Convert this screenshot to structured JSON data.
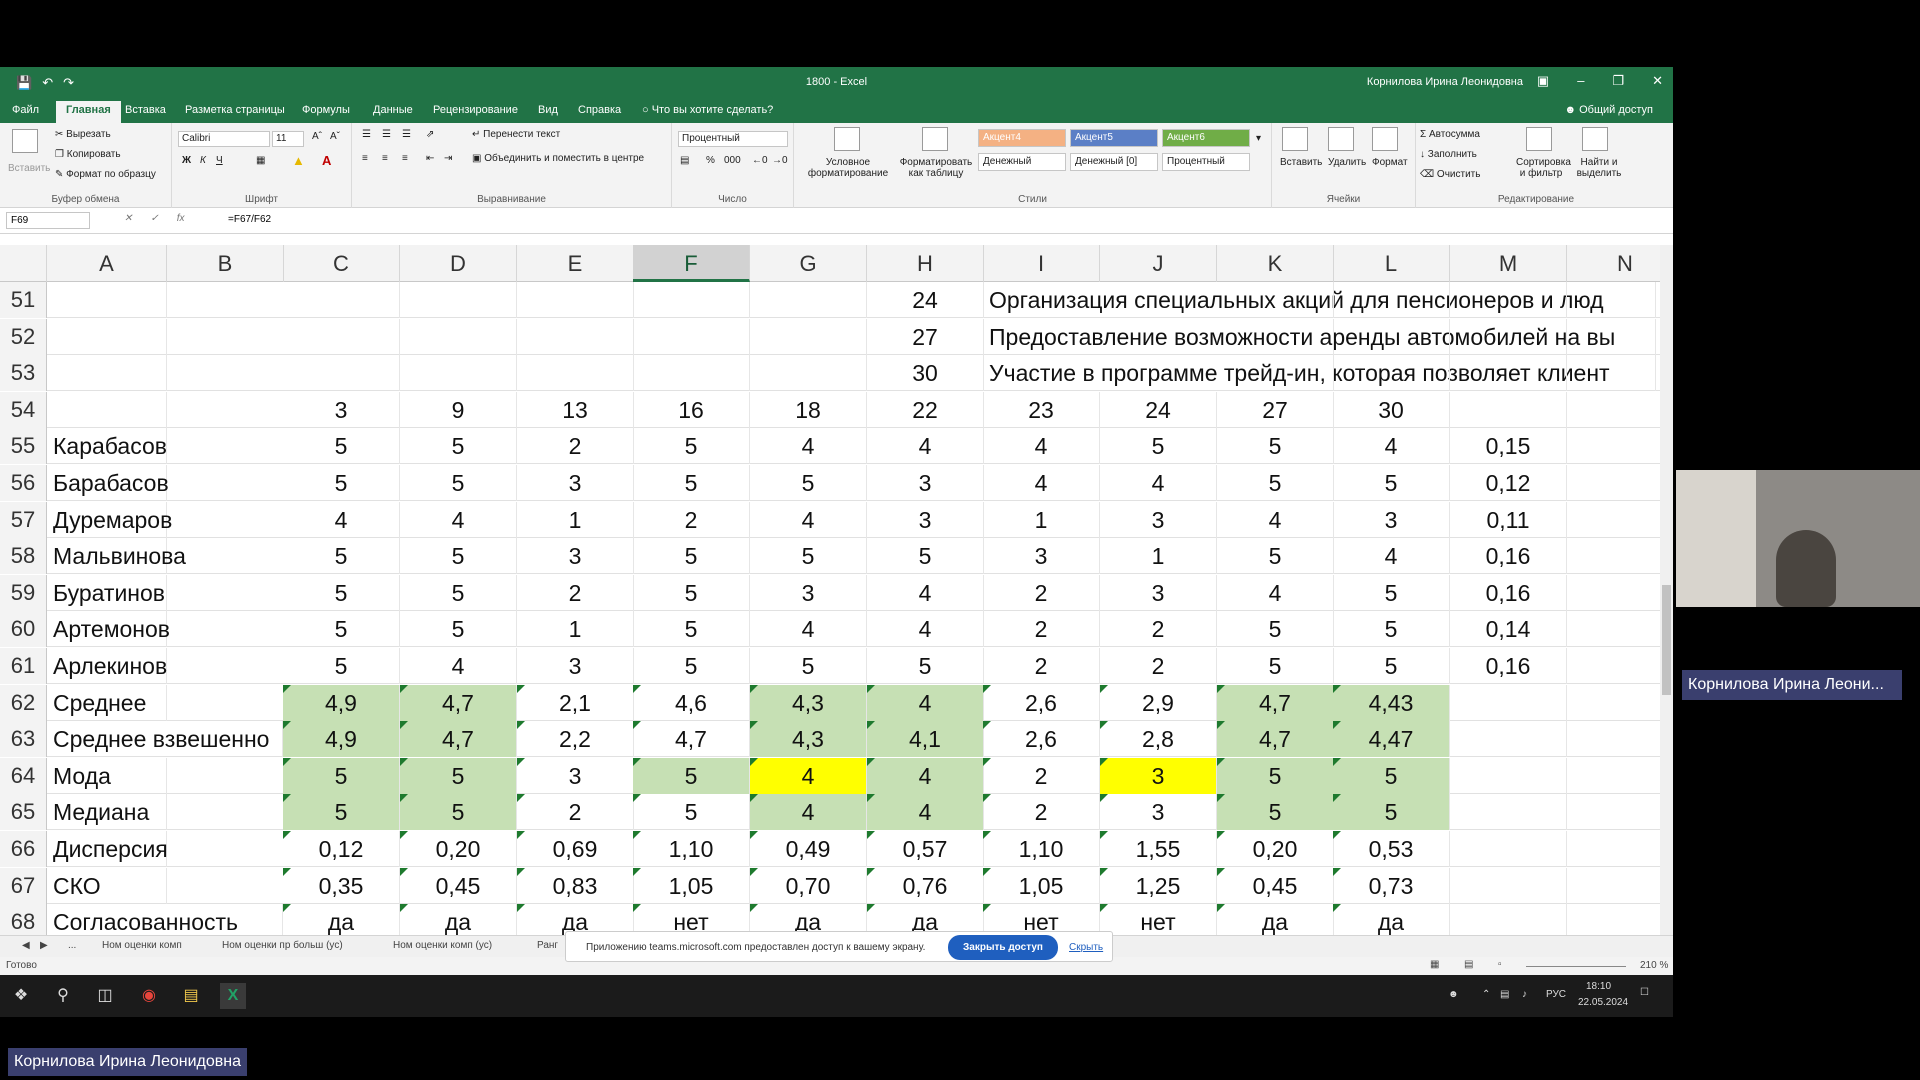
{
  "title": {
    "doc": "1800",
    "app": "Excel",
    "user": "Корнилова Ирина Леонидовна"
  },
  "tabs": [
    "Файл",
    "Главная",
    "Вставка",
    "Разметка страницы",
    "Формулы",
    "Данные",
    "Рецензирование",
    "Вид",
    "Справка",
    "Что вы хотите сделать?"
  ],
  "share": "Общий доступ",
  "ribbon": {
    "clipboard": {
      "paste": "Вставить",
      "cut": "Вырезать",
      "copy": "Копировать",
      "format_painter": "Формат по образцу",
      "label": "Буфер обмена"
    },
    "font": {
      "name": "Calibri",
      "size": "11",
      "bold": "Ж",
      "italic": "К",
      "underline": "Ч",
      "label": "Шрифт"
    },
    "alignment": {
      "wrap": "Перенести текст",
      "merge": "Объединить и поместить в центре",
      "label": "Выравнивание"
    },
    "number": {
      "format": "Процентный",
      "label": "Число"
    },
    "styles": {
      "cond": "Условное форматирование",
      "table": "Форматировать как таблицу",
      "a4": "Акцент4",
      "a5": "Акцент5",
      "a6": "Акцент6",
      "money": "Денежный",
      "money0": "Денежный [0]",
      "pct": "Процентный",
      "label": "Стили"
    },
    "cells": {
      "insert": "Вставить",
      "delete": "Удалить",
      "format": "Формат",
      "label": "Ячейки"
    },
    "editing": {
      "autosum": "Автосумма",
      "fill": "Заполнить",
      "clear": "Очистить",
      "sort": "Сортировка и фильтр",
      "find": "Найти и выделить",
      "label": "Редактирование"
    }
  },
  "namebox": "F69",
  "formula": "=F67/F62",
  "columns": [
    "A",
    "B",
    "C",
    "D",
    "E",
    "F",
    "G",
    "H",
    "I",
    "J",
    "K",
    "L",
    "M",
    "N"
  ],
  "rows": [
    {
      "n": "51",
      "A": "",
      "C": "",
      "D": "",
      "E": "",
      "F": "",
      "G": "",
      "H": "24",
      "I": "Организация специальных акций для пенсионеров и люд",
      "K": "",
      "L": "",
      "M": ""
    },
    {
      "n": "52",
      "A": "",
      "C": "",
      "D": "",
      "E": "",
      "F": "",
      "G": "",
      "H": "27",
      "I": "Предоставление возможности аренды автомобилей на вы",
      "K": "",
      "L": "",
      "M": ""
    },
    {
      "n": "53",
      "A": "",
      "C": "",
      "D": "",
      "E": "",
      "F": "",
      "G": "",
      "H": "30",
      "I": "Участие в программе трейд-ин, которая позволяет клиент",
      "K": "",
      "L": "",
      "M": ""
    },
    {
      "n": "54",
      "A": "",
      "C": "3",
      "D": "9",
      "E": "13",
      "F": "16",
      "G": "18",
      "H": "22",
      "I": "23",
      "J": "24",
      "K": "27",
      "L": "30",
      "M": ""
    },
    {
      "n": "55",
      "A": "Карабасов",
      "C": "5",
      "D": "5",
      "E": "2",
      "F": "5",
      "G": "4",
      "H": "4",
      "I": "4",
      "J": "5",
      "K": "5",
      "L": "4",
      "M": "0,15"
    },
    {
      "n": "56",
      "A": "Барабасов",
      "C": "5",
      "D": "5",
      "E": "3",
      "F": "5",
      "G": "5",
      "H": "3",
      "I": "4",
      "J": "4",
      "K": "5",
      "L": "5",
      "M": "0,12"
    },
    {
      "n": "57",
      "A": "Дуремаров",
      "C": "4",
      "D": "4",
      "E": "1",
      "F": "2",
      "G": "4",
      "H": "3",
      "I": "1",
      "J": "3",
      "K": "4",
      "L": "3",
      "M": "0,11"
    },
    {
      "n": "58",
      "A": "Мальвинова",
      "C": "5",
      "D": "5",
      "E": "3",
      "F": "5",
      "G": "5",
      "H": "5",
      "I": "3",
      "J": "1",
      "K": "5",
      "L": "4",
      "M": "0,16"
    },
    {
      "n": "59",
      "A": "Буратинов",
      "C": "5",
      "D": "5",
      "E": "2",
      "F": "5",
      "G": "3",
      "H": "4",
      "I": "2",
      "J": "3",
      "K": "4",
      "L": "5",
      "M": "0,16"
    },
    {
      "n": "60",
      "A": "Артемонов",
      "C": "5",
      "D": "5",
      "E": "1",
      "F": "5",
      "G": "4",
      "H": "4",
      "I": "2",
      "J": "2",
      "K": "5",
      "L": "5",
      "M": "0,14"
    },
    {
      "n": "61",
      "A": "Арлекинов",
      "C": "5",
      "D": "4",
      "E": "3",
      "F": "5",
      "G": "5",
      "H": "5",
      "I": "2",
      "J": "2",
      "K": "5",
      "L": "5",
      "M": "0,16"
    },
    {
      "n": "62",
      "A": "Среднее",
      "C": "4,9",
      "D": "4,7",
      "E": "2,1",
      "F": "4,6",
      "G": "4,3",
      "H": "4",
      "I": "2,6",
      "J": "2,9",
      "K": "4,7",
      "L": "4,43",
      "M": ""
    },
    {
      "n": "63",
      "A": "Среднее взвешенно",
      "C": "4,9",
      "D": "4,7",
      "E": "2,2",
      "F": "4,7",
      "G": "4,3",
      "H": "4,1",
      "I": "2,6",
      "J": "2,8",
      "K": "4,7",
      "L": "4,47",
      "M": ""
    },
    {
      "n": "64",
      "A": "Мода",
      "C": "5",
      "D": "5",
      "E": "3",
      "F": "5",
      "G": "4",
      "H": "4",
      "I": "2",
      "J": "3",
      "K": "5",
      "L": "5",
      "M": ""
    },
    {
      "n": "65",
      "A": "Медиана",
      "C": "5",
      "D": "5",
      "E": "2",
      "F": "5",
      "G": "4",
      "H": "4",
      "I": "2",
      "J": "3",
      "K": "5",
      "L": "5",
      "M": ""
    },
    {
      "n": "66",
      "A": "Дисперсия",
      "C": "0,12",
      "D": "0,20",
      "E": "0,69",
      "F": "1,10",
      "G": "0,49",
      "H": "0,57",
      "I": "1,10",
      "J": "1,55",
      "K": "0,20",
      "L": "0,53",
      "M": ""
    },
    {
      "n": "67",
      "A": "СКО",
      "C": "0,35",
      "D": "0,45",
      "E": "0,83",
      "F": "1,05",
      "G": "0,70",
      "H": "0,76",
      "I": "1,05",
      "J": "1,25",
      "K": "0,45",
      "L": "0,73",
      "M": ""
    },
    {
      "n": "68",
      "A": "Согласованность",
      "C": "да",
      "D": "да",
      "E": "да",
      "F": "нет",
      "G": "да",
      "H": "да",
      "I": "нет",
      "J": "нет",
      "K": "да",
      "L": "да",
      "M": ""
    }
  ],
  "sheets": [
    "...",
    "Ном оценки комп",
    "Ном оценки пр больш (ус)",
    "Ном оценки комп (ус)",
    "Ранг"
  ],
  "status": {
    "ready": "Готово",
    "zoom": "210 %"
  },
  "notify": {
    "msg": "Приложению teams.microsoft.com предоставлен доступ к вашему экрану.",
    "stop": "Закрыть доступ",
    "hide": "Скрыть"
  },
  "taskbar": {
    "lang": "РУС",
    "time": "18:10",
    "date": "22.05.2024"
  },
  "presenter": "Корнилова Ирина Леони...",
  "participant": "Корнилова Ирина Леонидовна"
}
